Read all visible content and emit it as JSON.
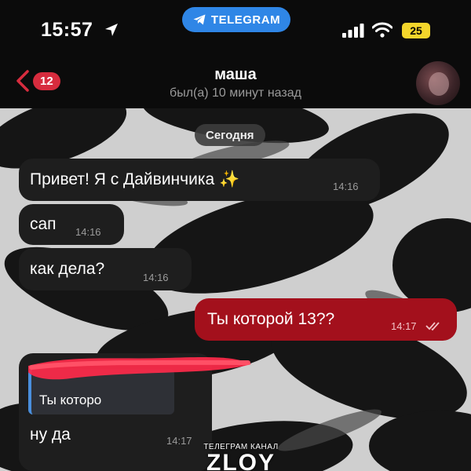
{
  "status_bar": {
    "time": "15:57",
    "app_pill": "TELEGRAM",
    "battery": "25",
    "icons": [
      "location-arrow-icon",
      "telegram-icon",
      "signal-icon",
      "wifi-icon",
      "battery-icon"
    ]
  },
  "header": {
    "unread_count": "12",
    "title": "маша",
    "status": "был(а) 10 минут назад",
    "icons": [
      "chevron-left-icon",
      "avatar"
    ]
  },
  "chat": {
    "date_separator": "Сегодня",
    "messages": [
      {
        "text": "Привет! Я с Дайвинчика ✨",
        "time": "14:16",
        "direction": "incoming"
      },
      {
        "text": "сап",
        "time": "14:16",
        "direction": "incoming"
      },
      {
        "text": "как дела?",
        "time": "14:16",
        "direction": "incoming"
      },
      {
        "text": "Ты которой 13??",
        "time": "14:17",
        "direction": "outgoing",
        "status": "read"
      },
      {
        "reply_to": "Ты которо",
        "text": "ну да",
        "time": "14:17",
        "direction": "incoming"
      }
    ]
  },
  "watermark": {
    "small": "ТЕЛЕГРАМ КАНАЛ",
    "big": "ZLOY"
  },
  "colors": {
    "outgoing_bubble": "#a3101c",
    "incoming_bubble": "#1e1e1e",
    "telegram_pill": "#2f86e6",
    "unread_badge": "#d72c3e",
    "battery": "#f3d52b",
    "reply_accent": "#4a8fdd",
    "redaction": "#ff2a4a"
  }
}
